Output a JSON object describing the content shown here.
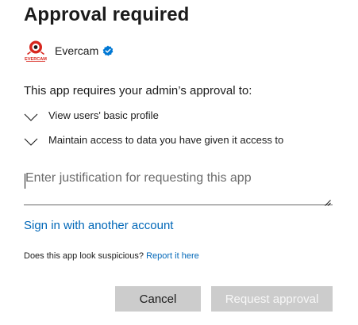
{
  "dialog": {
    "title": "Approval required"
  },
  "app": {
    "name": "Evercam",
    "logo_text": "EVERCAM",
    "logo_icon": "evercam-logo-icon",
    "verified_icon": "verified-badge-icon",
    "brand_color": "#d7261e",
    "verified_color": "#0078d4"
  },
  "consent": {
    "intro": "This app requires your admin’s approval to:",
    "permissions": [
      {
        "label": "View users' basic profile",
        "icon": "chevron-down-icon"
      },
      {
        "label": "Maintain access to data you have given it access to",
        "icon": "chevron-down-icon"
      }
    ]
  },
  "justification": {
    "value": "",
    "placeholder": "Enter justification for requesting this app"
  },
  "links": {
    "sign_in_other": "Sign in with another account",
    "suspicious_prefix": "Does this app look suspicious?",
    "report": "Report it here",
    "link_color": "#0067b8"
  },
  "buttons": {
    "cancel": "Cancel",
    "request": "Request approval"
  }
}
